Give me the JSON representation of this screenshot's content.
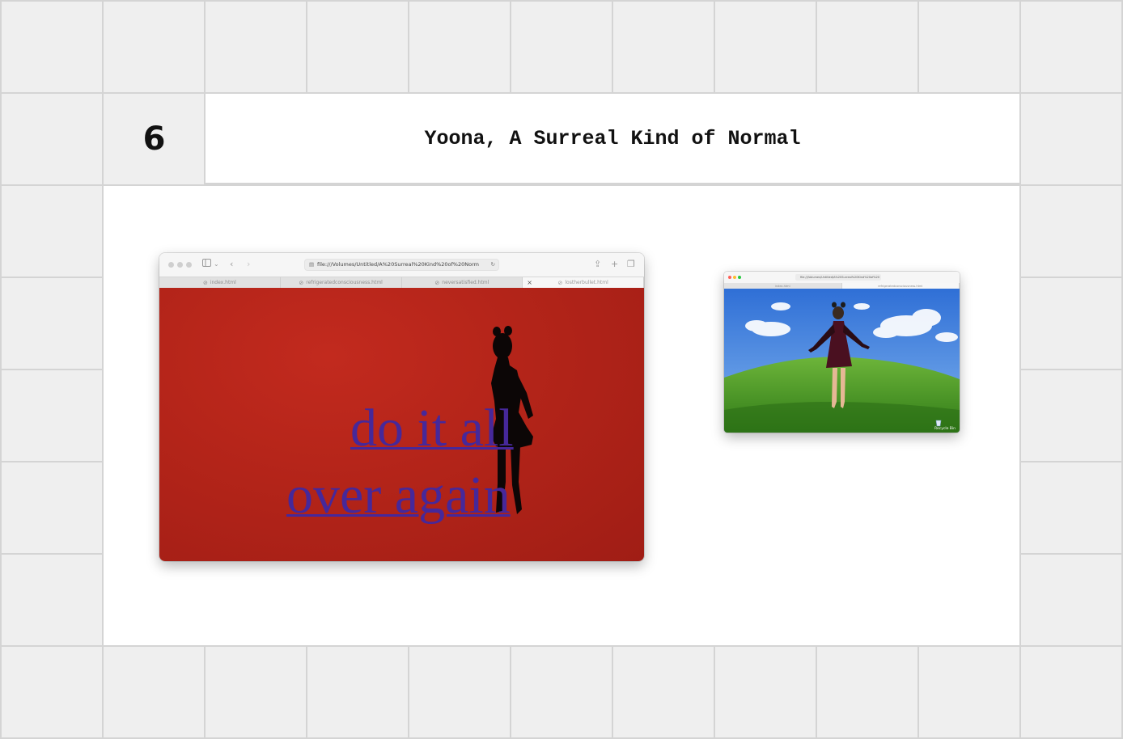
{
  "slide": {
    "number": "6",
    "title": "Yoona, A Surreal Kind of Normal"
  },
  "large_window": {
    "url": "file:///Volumes/Untitled/A%20Surreal%20Kind%20of%20Norm",
    "tabs": [
      {
        "label": "index.html",
        "active": false
      },
      {
        "label": "refrigeratedconsciousness.html",
        "active": false
      },
      {
        "label": "neversatisfied.html",
        "active": false
      },
      {
        "label": "lostherbullet.html",
        "active": true
      }
    ],
    "link_line1": "do it all",
    "link_line2": "over again",
    "close_glyph": "×"
  },
  "small_window": {
    "url": "file:///Volumes/Untitled/A%20Surreal%20Kind%20of%20",
    "tabs": [
      {
        "label": "index.html",
        "active": false
      },
      {
        "label": "refrigeratedconsciousness.html",
        "active": true
      }
    ],
    "recycle_label": "Recycle Bin"
  },
  "colors": {
    "page_bg": "#efefef",
    "grid_line": "#d4d4d4",
    "red_page": "#b32419",
    "link": "#46289a",
    "sky": "#3a79d8",
    "grass": "#4f9a25"
  },
  "icons": [
    "sidebar-icon",
    "back-chevron-icon",
    "forward-chevron-icon",
    "lock-icon",
    "reload-icon",
    "share-icon",
    "plus-icon",
    "tabs-icon",
    "compass-icon",
    "recycle-bin-icon"
  ]
}
